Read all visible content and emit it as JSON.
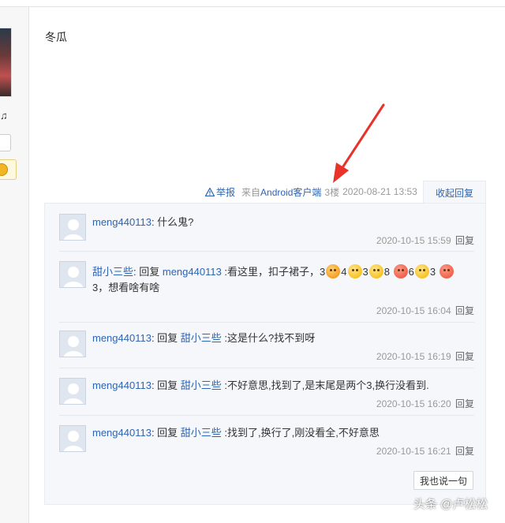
{
  "post": {
    "content": "冬瓜"
  },
  "left_col": {
    "note_glyph": "♫"
  },
  "meta": {
    "report_label": "举报",
    "client_prefix": "来自",
    "client_name": "Android客户端",
    "floor": "3楼",
    "time": "2020-08-21 13:53",
    "collapse_label": "收起回复"
  },
  "replies": [
    {
      "user": "meng440113",
      "sep": ":",
      "reply_word": "",
      "target": "",
      "text": " 什么鬼?",
      "time": "2020-10-15 15:59",
      "reply_label": "回复"
    },
    {
      "user": "甜小三些",
      "sep": ":",
      "reply_word": " 回复 ",
      "target": "meng440113",
      "text_a": " :看这里，扣子裙子，3",
      "e_a": "4",
      "e_b": "3",
      "e_c": "8",
      "e_d": "6",
      "e_e": "3",
      "text_b": "3，想看啥有啥",
      "time": "2020-10-15 16:04",
      "reply_label": "回复"
    },
    {
      "user": "meng440113",
      "sep": ":",
      "reply_word": " 回复 ",
      "target": "甜小三些",
      "text": " :这是什么?找不到呀",
      "time": "2020-10-15 16:19",
      "reply_label": "回复"
    },
    {
      "user": "meng440113",
      "sep": ":",
      "reply_word": " 回复 ",
      "target": "甜小三些",
      "text": " :不好意思,找到了,是末尾是两个3,换行没看到.",
      "time": "2020-10-15 16:20",
      "reply_label": "回复"
    },
    {
      "user": "meng440113",
      "sep": ":",
      "reply_word": " 回复 ",
      "target": "甜小三些",
      "text": " :找到了,换行了,刚没看全,不好意思",
      "time": "2020-10-15 16:21",
      "reply_label": "回复"
    }
  ],
  "say_button": "我也说一句",
  "watermark": "头条 @卢松松",
  "colors": {
    "link": "#2d64b3",
    "muted": "#999999",
    "reply_box_bg": "#f5f7fa",
    "arrow": "#e8322a"
  },
  "icons": [
    "warning-icon",
    "default-avatar-icon",
    "emoji-icon",
    "red-arrow-icon",
    "music-note-icon",
    "coin-badge-icon"
  ]
}
